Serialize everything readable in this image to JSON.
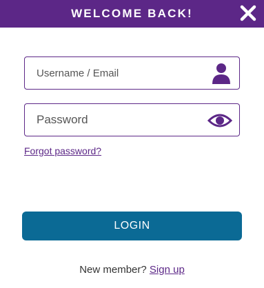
{
  "header": {
    "title": "WELCOME BACK!",
    "close_icon": "close-icon",
    "background": "#5c2787"
  },
  "username": {
    "placeholder": "Username / Email",
    "value": "",
    "icon": "user-icon"
  },
  "password": {
    "placeholder": "Password",
    "value": "",
    "icon": "eye-icon"
  },
  "forgot_password": {
    "label": "Forgot password?"
  },
  "login_button": {
    "label": "LOGIN",
    "color": "#0b6a95"
  },
  "signup": {
    "prompt": "New member?",
    "link_label": "Sign up"
  },
  "colors": {
    "accent": "#5c2787",
    "primary_button": "#0b6a95"
  }
}
